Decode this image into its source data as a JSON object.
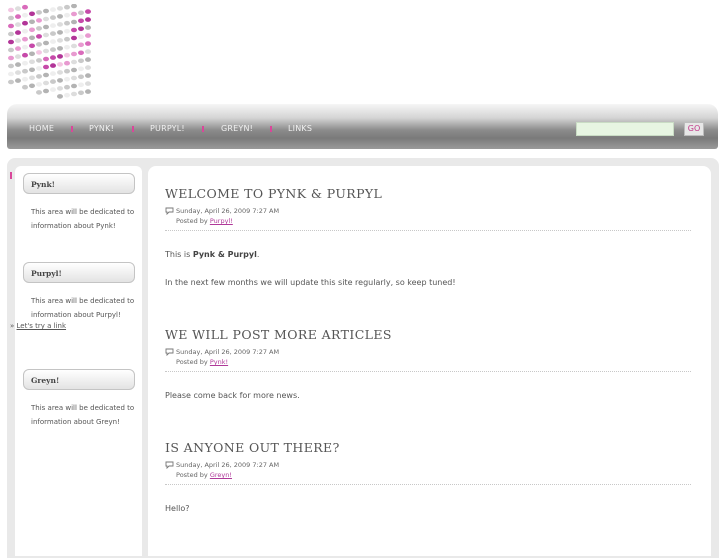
{
  "nav": {
    "items": [
      "HOME",
      "PYNK!",
      "PURPYL!",
      "GREYN!",
      "LINKS"
    ],
    "search_placeholder": "",
    "go_label": "GO"
  },
  "sidebar": {
    "boxes": [
      {
        "title": "Pynk!",
        "text": [
          "This area will be dedicated to",
          "information about Pynk!"
        ]
      },
      {
        "title": "Purpyl!",
        "text": [
          "This area will be dedicated to",
          "information about Purpyl!"
        ],
        "link_prefix": "»",
        "link": "Let's try a link"
      },
      {
        "title": "Greyn!",
        "text": [
          "This area will be dedicated to",
          "information about Greyn!"
        ]
      }
    ]
  },
  "posts": [
    {
      "title": "WELCOME TO PYNK & PURPYL",
      "date": "Sunday, April 26, 2009 7:27 AM",
      "posted_by": "Posted by",
      "author": "Purpyl!",
      "body": [
        {
          "pre": "This is ",
          "bold": "Pynk & Purpyl",
          "post": "."
        },
        {
          "pre": "In the next few months we will update this site regularly, so keep tuned!",
          "bold": "",
          "post": ""
        }
      ]
    },
    {
      "title": "WE WILL POST MORE ARTICLES",
      "date": "Sunday, April 26, 2009 7:27 AM",
      "posted_by": "Posted by",
      "author": "Pynk!",
      "body": [
        {
          "pre": "Please come back for more news.",
          "bold": "",
          "post": ""
        }
      ]
    },
    {
      "title": "IS ANYONE OUT THERE?",
      "date": "Sunday, April 26, 2009 7:27 AM",
      "posted_by": "Posted by",
      "author": "Greyn!",
      "body": [
        {
          "pre": "Hello?",
          "bold": "",
          "post": ""
        }
      ]
    }
  ],
  "colors": {
    "accent": "#d9479a",
    "link": "#b03899"
  }
}
